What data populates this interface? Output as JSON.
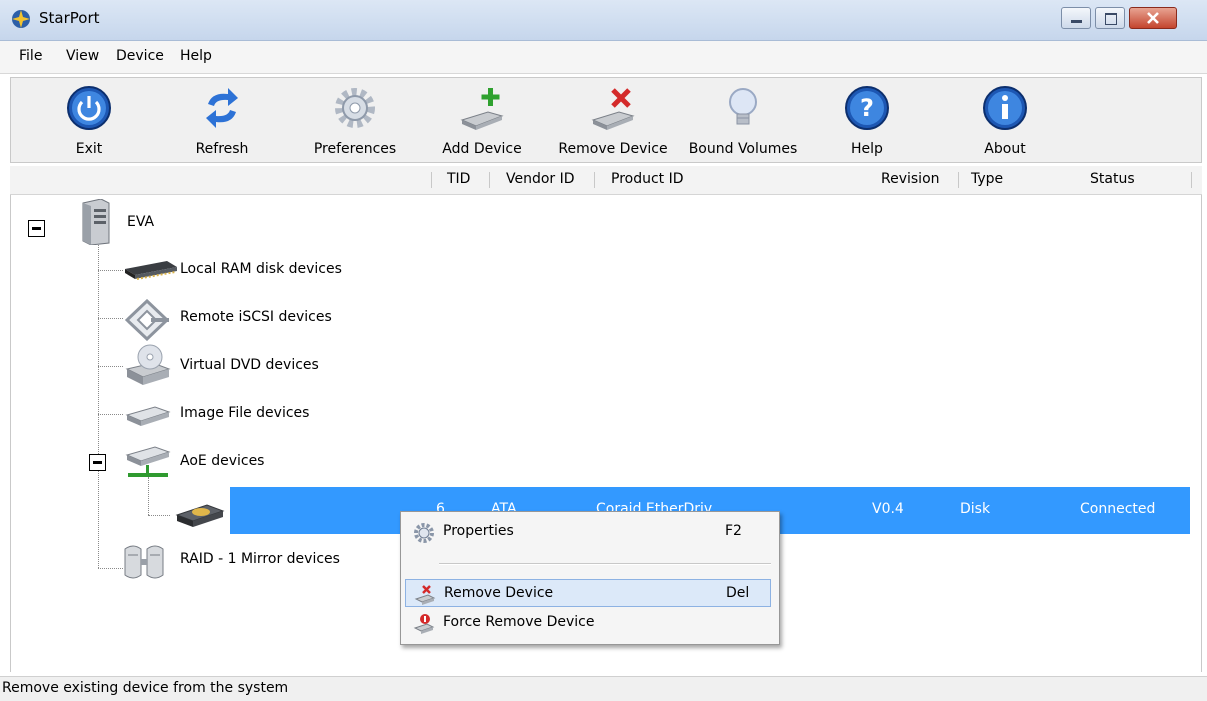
{
  "window": {
    "title": "StarPort"
  },
  "menu": [
    "File",
    "View",
    "Device",
    "Help"
  ],
  "toolbar": {
    "exit": "Exit",
    "refresh": "Refresh",
    "preferences": "Preferences",
    "add_device": "Add Device",
    "remove_device": "Remove Device",
    "bound_volumes": "Bound Volumes",
    "help": "Help",
    "about": "About"
  },
  "columns": {
    "tid": "TID",
    "vendor_id": "Vendor ID",
    "product_id": "Product ID",
    "revision": "Revision",
    "type": "Type",
    "status": "Status"
  },
  "tree": {
    "root": "EVA",
    "nodes": {
      "ram": "Local RAM disk devices",
      "iscsi": "Remote iSCSI devices",
      "dvd": "Virtual DVD devices",
      "image": "Image File devices",
      "aoe": "AoE devices",
      "raid": "RAID - 1 Mirror devices"
    },
    "selected_device": {
      "tid": "6",
      "vendor_id": "ATA",
      "product_id": "Coraid EtherDriv",
      "revision": "V0.4",
      "type": "Disk",
      "status": "Connected"
    }
  },
  "context_menu": {
    "properties": {
      "label": "Properties",
      "shortcut": "F2"
    },
    "remove": {
      "label": "Remove Device",
      "shortcut": "Del"
    },
    "force_remove": {
      "label": "Force Remove Device"
    }
  },
  "statusbar": {
    "text": "Remove existing device from the system"
  },
  "colors": {
    "selection": "#3399ff",
    "toolbar_bg": "#f0f0f0",
    "title_gradient_top": "#dce7f5"
  }
}
